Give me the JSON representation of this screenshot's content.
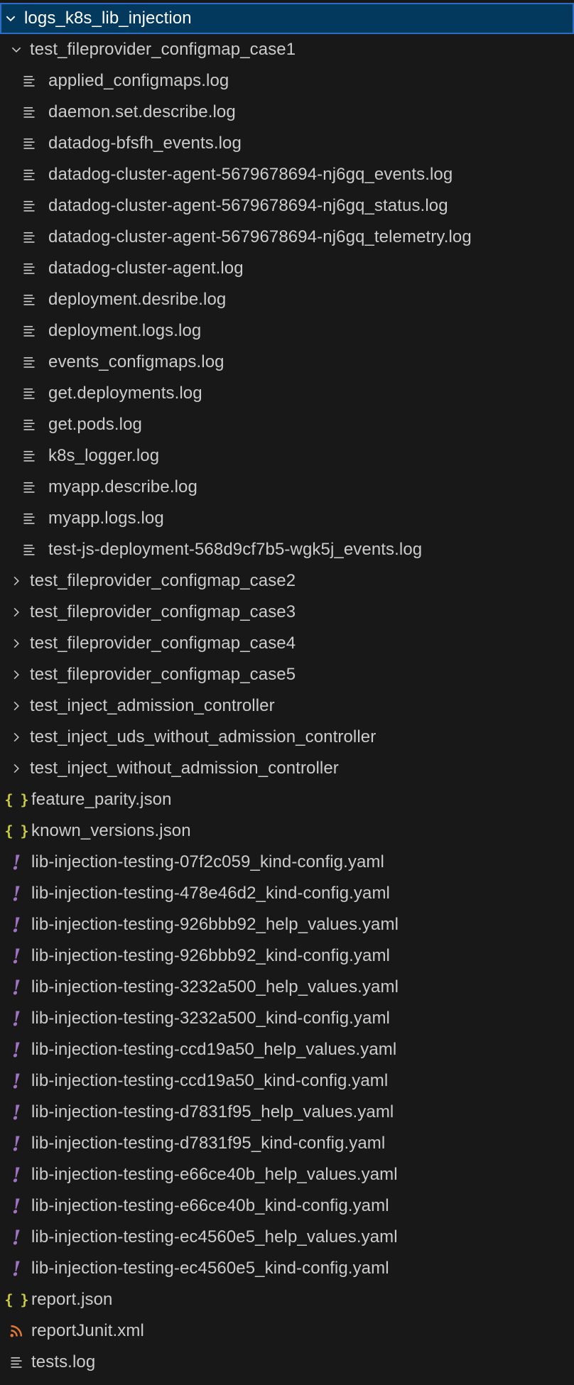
{
  "root": {
    "label": "logs_k8s_lib_injection"
  },
  "expanded_folder": {
    "label": "test_fileprovider_configmap_case1",
    "files": [
      "applied_configmaps.log",
      "daemon.set.describe.log",
      "datadog-bfsfh_events.log",
      "datadog-cluster-agent-5679678694-nj6gq_events.log",
      "datadog-cluster-agent-5679678694-nj6gq_status.log",
      "datadog-cluster-agent-5679678694-nj6gq_telemetry.log",
      "datadog-cluster-agent.log",
      "deployment.desribe.log",
      "deployment.logs.log",
      "events_configmaps.log",
      "get.deployments.log",
      "get.pods.log",
      "k8s_logger.log",
      "myapp.describe.log",
      "myapp.logs.log",
      "test-js-deployment-568d9cf7b5-wgk5j_events.log"
    ]
  },
  "collapsed_folders": [
    "test_fileprovider_configmap_case2",
    "test_fileprovider_configmap_case3",
    "test_fileprovider_configmap_case4",
    "test_fileprovider_configmap_case5",
    "test_inject_admission_controller",
    "test_inject_uds_without_admission_controller",
    "test_inject_without_admission_controller"
  ],
  "root_files": [
    {
      "label": "feature_parity.json",
      "icon": "json-icon"
    },
    {
      "label": "known_versions.json",
      "icon": "json-icon"
    },
    {
      "label": "lib-injection-testing-07f2c059_kind-config.yaml",
      "icon": "yaml-icon"
    },
    {
      "label": "lib-injection-testing-478e46d2_kind-config.yaml",
      "icon": "yaml-icon"
    },
    {
      "label": "lib-injection-testing-926bbb92_help_values.yaml",
      "icon": "yaml-icon"
    },
    {
      "label": "lib-injection-testing-926bbb92_kind-config.yaml",
      "icon": "yaml-icon"
    },
    {
      "label": "lib-injection-testing-3232a500_help_values.yaml",
      "icon": "yaml-icon"
    },
    {
      "label": "lib-injection-testing-3232a500_kind-config.yaml",
      "icon": "yaml-icon"
    },
    {
      "label": "lib-injection-testing-ccd19a50_help_values.yaml",
      "icon": "yaml-icon"
    },
    {
      "label": "lib-injection-testing-ccd19a50_kind-config.yaml",
      "icon": "yaml-icon"
    },
    {
      "label": "lib-injection-testing-d7831f95_help_values.yaml",
      "icon": "yaml-icon"
    },
    {
      "label": "lib-injection-testing-d7831f95_kind-config.yaml",
      "icon": "yaml-icon"
    },
    {
      "label": "lib-injection-testing-e66ce40b_help_values.yaml",
      "icon": "yaml-icon"
    },
    {
      "label": "lib-injection-testing-e66ce40b_kind-config.yaml",
      "icon": "yaml-icon"
    },
    {
      "label": "lib-injection-testing-ec4560e5_help_values.yaml",
      "icon": "yaml-icon"
    },
    {
      "label": "lib-injection-testing-ec4560e5_kind-config.yaml",
      "icon": "yaml-icon"
    },
    {
      "label": "report.json",
      "icon": "json-icon"
    },
    {
      "label": "reportJunit.xml",
      "icon": "rss-icon"
    },
    {
      "label": "tests.log",
      "icon": "text-file-icon"
    }
  ],
  "colors": {
    "background": "#181818",
    "selection": "#04395e",
    "selection_border": "#2b6cc4",
    "text": "#cccccc",
    "json_icon": "#cbcb41",
    "yaml_icon": "#a074c4",
    "rss_icon": "#e37933"
  }
}
